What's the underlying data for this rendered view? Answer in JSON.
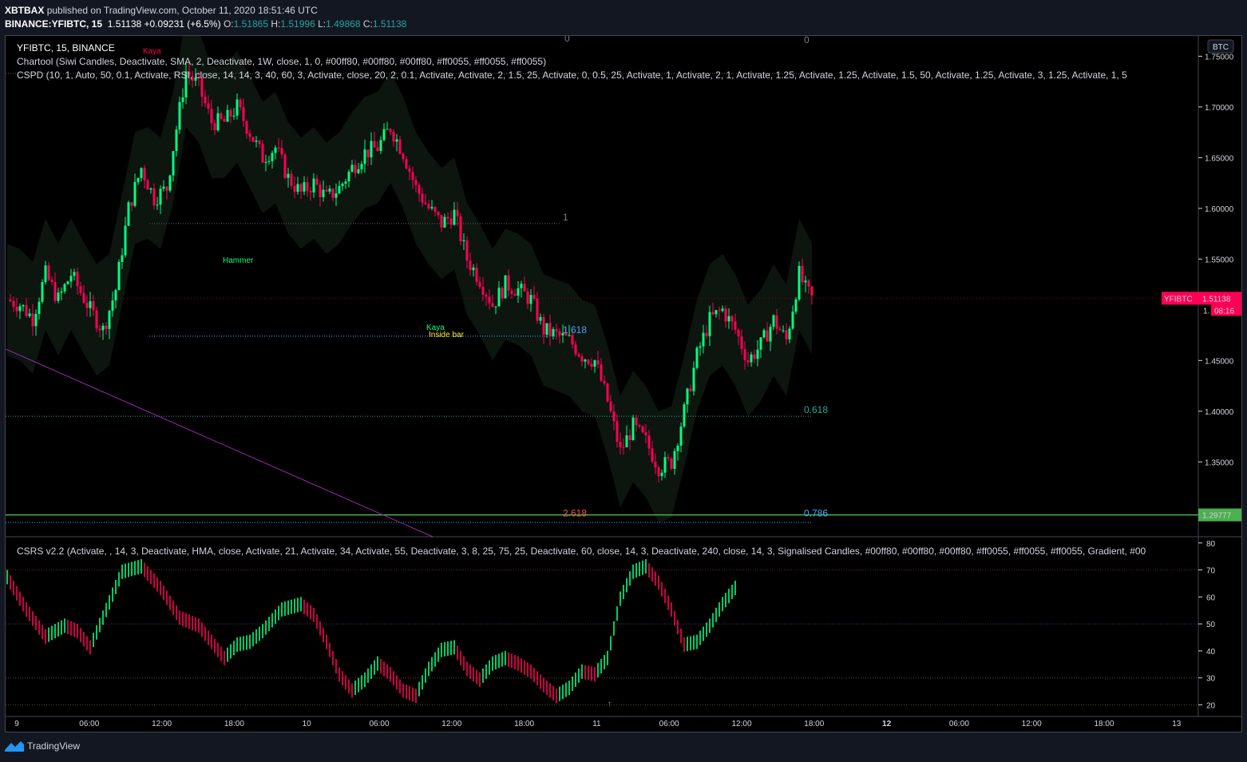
{
  "header": {
    "author": "XBTBAX",
    "published_text": "published on TradingView.com, October 11, 2020 18:51:46 UTC",
    "symbol_line": "BINANCE:YFIBTC, 15",
    "last": "1.51138",
    "change": "+0.09231 (+6.5%)",
    "o_label": "O:",
    "o": "1.51865",
    "h_label": "H:",
    "h": "1.51996",
    "l_label": "L:",
    "l": "1.49868",
    "c_label": "C:",
    "c": "1.51138"
  },
  "legend": {
    "title": "YFIBTC, 15, BINANCE",
    "chartool": "Chartool (Siwi Candles, Deactivate, SMA, 2, Deactivate, 1W, close, 1, 0, #00ff80, #00ff80, #00ff80, #ff0055, #ff0055, #ff0055)",
    "cspd": "CSPD (10, 1, Auto, 50, 0.1, Activate, RSI, close, 14, 14, 3, 40, 60, 3, Activate, close, 20, 2, 0.1, Activate, Activate, 2, 1.5, 25, Activate, 0, 0.5, 25, Activate, 1, Activate, 2, 1, Activate, 1.25, Activate, 1.25, Activate, 1.5, 50, Activate, 1.25, Activate, 3, 1.25, Activate, 1, 5",
    "csrs": "CSRS v2.2 (Activate, , 14, 3, Deactivate, HMA, close, Activate, 21, Activate, 34, Activate, 55, Deactivate, 3, 8, 25, 75, 25, Deactivate, 60, close, 14, 3, Deactivate, 240, close, 14, 3, Signalised Candles, #00ff80, #00ff80, #00ff80, #ff0055, #ff0055, #ff0055, Gradient, #00"
  },
  "currency_badge": "BTC",
  "price_label": {
    "symbol": "YFIBTC",
    "value": "1.51138",
    "countdown": "08:16",
    "partial": "1."
  },
  "green_line_label": "1.29777",
  "fib_labels": {
    "left_top": "0",
    "left_1": "1",
    "left_1618": "1.618",
    "left_2618": "2.618",
    "right_top": "0",
    "right_0618": "0.618",
    "right_0786": "0.786"
  },
  "annotations": {
    "kaya_top": "Kaya",
    "hammer": "Hammer",
    "kaya_mid": "Kaya",
    "inside_bar": "Inside bar",
    "arrow_up": "↑"
  },
  "footer": {
    "brand": "TradingView"
  },
  "colors": {
    "up": "#00ff80",
    "down": "#ff0055",
    "bg": "#000000",
    "panel": "#131722",
    "grid_dot": "#4a4e8a",
    "green_line": "#4caf50",
    "purple_line": "#9c27b0",
    "fib_blue": "#42a5f5",
    "fib_teal": "#26a69a",
    "fib_red": "#ef5350"
  },
  "chart_data": [
    {
      "type": "candlestick",
      "title": "BINANCE:YFIBTC, 15",
      "xlabel": "",
      "ylabel": "BTC",
      "y_ticks": [
        "1.75000",
        "1.70000",
        "1.65000",
        "1.60000",
        "1.55000",
        "1.45000",
        "1.40000",
        "1.35000"
      ],
      "x_ticks": [
        "9",
        "06:00",
        "12:00",
        "18:00",
        "10",
        "06:00",
        "12:00",
        "18:00",
        "11",
        "06:00",
        "12:00",
        "18:00",
        "12",
        "06:00",
        "12:00",
        "18:00",
        "13"
      ],
      "ylim": [
        1.277,
        1.77
      ],
      "last_price": 1.51138,
      "horizontal_level": 1.29777,
      "fib_levels": [
        {
          "label": "0",
          "value": 1.733
        },
        {
          "label": "1",
          "value": 1.585
        },
        {
          "label": "1.618",
          "value": 1.474
        },
        {
          "label": "2.618",
          "value": 1.295
        },
        {
          "label": "0",
          "value": 1.733
        },
        {
          "label": "0.618",
          "value": 1.395
        },
        {
          "label": "0.786",
          "value": 1.295
        }
      ],
      "close_path": [
        [
          0,
          1.51
        ],
        [
          4,
          1.505
        ],
        [
          8,
          1.492
        ],
        [
          12,
          1.535
        ],
        [
          16,
          1.51
        ],
        [
          20,
          1.535
        ],
        [
          26,
          1.5
        ],
        [
          30,
          1.48
        ],
        [
          34,
          1.52
        ],
        [
          38,
          1.6
        ],
        [
          42,
          1.64
        ],
        [
          46,
          1.61
        ],
        [
          50,
          1.62
        ],
        [
          52,
          1.66
        ],
        [
          56,
          1.735
        ],
        [
          60,
          1.72
        ],
        [
          64,
          1.685
        ],
        [
          68,
          1.685
        ],
        [
          72,
          1.7
        ],
        [
          76,
          1.675
        ],
        [
          80,
          1.65
        ],
        [
          84,
          1.66
        ],
        [
          88,
          1.63
        ],
        [
          92,
          1.615
        ],
        [
          96,
          1.625
        ],
        [
          100,
          1.61
        ],
        [
          104,
          1.62
        ],
        [
          108,
          1.64
        ],
        [
          112,
          1.655
        ],
        [
          116,
          1.66
        ],
        [
          120,
          1.68
        ],
        [
          124,
          1.655
        ],
        [
          128,
          1.62
        ],
        [
          132,
          1.6
        ],
        [
          136,
          1.585
        ],
        [
          140,
          1.595
        ],
        [
          144,
          1.55
        ],
        [
          148,
          1.53
        ],
        [
          152,
          1.505
        ],
        [
          156,
          1.525
        ],
        [
          160,
          1.52
        ],
        [
          164,
          1.51
        ],
        [
          168,
          1.48
        ],
        [
          172,
          1.475
        ],
        [
          176,
          1.47
        ],
        [
          180,
          1.455
        ],
        [
          184,
          1.45
        ],
        [
          188,
          1.41
        ],
        [
          192,
          1.36
        ],
        [
          196,
          1.385
        ],
        [
          200,
          1.37
        ],
        [
          204,
          1.345
        ],
        [
          208,
          1.35
        ],
        [
          212,
          1.4
        ],
        [
          216,
          1.455
        ],
        [
          220,
          1.49
        ],
        [
          224,
          1.5
        ],
        [
          228,
          1.48
        ],
        [
          232,
          1.45
        ],
        [
          236,
          1.465
        ],
        [
          240,
          1.49
        ],
        [
          244,
          1.47
        ],
        [
          248,
          1.535
        ],
        [
          250,
          1.52
        ],
        [
          252,
          1.511
        ]
      ],
      "bars_total": 252
    },
    {
      "type": "histogram",
      "title": "CSRS v2.2",
      "y_ticks": [
        "80",
        "70",
        "60",
        "50",
        "40",
        "30",
        "20"
      ],
      "ylim": [
        16,
        82
      ],
      "levels": [
        70,
        50,
        30,
        20
      ],
      "path": [
        [
          0,
          70
        ],
        [
          6,
          58
        ],
        [
          12,
          48
        ],
        [
          18,
          52
        ],
        [
          22,
          50
        ],
        [
          26,
          44
        ],
        [
          30,
          55
        ],
        [
          36,
          72
        ],
        [
          42,
          74
        ],
        [
          48,
          66
        ],
        [
          54,
          55
        ],
        [
          60,
          52
        ],
        [
          64,
          46
        ],
        [
          68,
          40
        ],
        [
          72,
          45
        ],
        [
          76,
          46
        ],
        [
          80,
          50
        ],
        [
          86,
          58
        ],
        [
          92,
          60
        ],
        [
          96,
          56
        ],
        [
          100,
          46
        ],
        [
          104,
          34
        ],
        [
          108,
          28
        ],
        [
          112,
          32
        ],
        [
          116,
          38
        ],
        [
          120,
          34
        ],
        [
          124,
          28
        ],
        [
          128,
          26
        ],
        [
          132,
          36
        ],
        [
          136,
          43
        ],
        [
          140,
          44
        ],
        [
          144,
          36
        ],
        [
          148,
          32
        ],
        [
          152,
          38
        ],
        [
          156,
          40
        ],
        [
          160,
          38
        ],
        [
          164,
          35
        ],
        [
          168,
          30
        ],
        [
          172,
          26
        ],
        [
          176,
          29
        ],
        [
          180,
          35
        ],
        [
          184,
          34
        ],
        [
          188,
          40
        ],
        [
          192,
          62
        ],
        [
          196,
          72
        ],
        [
          200,
          74
        ],
        [
          204,
          68
        ],
        [
          208,
          58
        ],
        [
          212,
          45
        ],
        [
          216,
          46
        ],
        [
          220,
          52
        ],
        [
          224,
          60
        ],
        [
          228,
          66
        ]
      ],
      "markers": [
        {
          "bar": 168,
          "label": "↑"
        }
      ]
    }
  ]
}
